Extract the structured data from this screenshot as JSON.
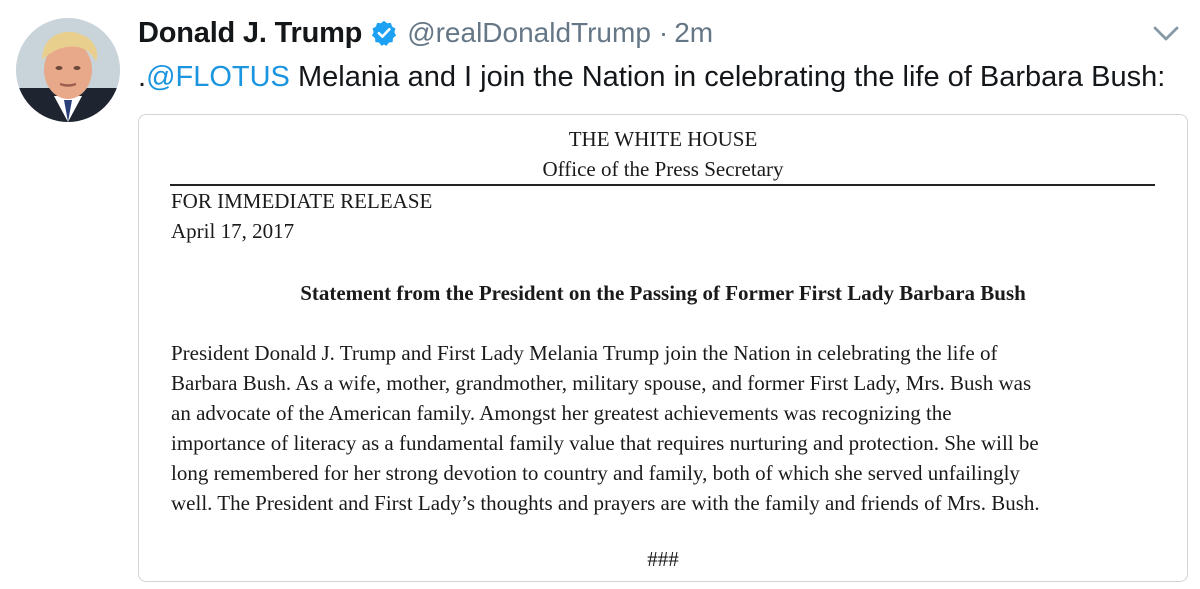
{
  "tweet": {
    "display_name": "Donald J. Trump",
    "handle": "@realDonaldTrump",
    "separator": "·",
    "time": "2m",
    "text_prefix": ".",
    "mention": "@FLOTUS",
    "text_rest": " Melania and I join the Nation in celebrating the life of Barbara Bush:",
    "icons": {
      "verified": "verified-badge-icon",
      "chevron": "chevron-down-icon",
      "avatar": "profile-avatar"
    },
    "colors": {
      "mention": "#1b95e0",
      "verified": "#1da1f2",
      "muted": "#657786"
    }
  },
  "document": {
    "org": "THE WHITE HOUSE",
    "office": "Office of the Press Secretary",
    "release": "FOR IMMEDIATE RELEASE",
    "date": "April 17, 2017",
    "title": "Statement from the President on the Passing of Former First Lady Barbara Bush",
    "body_lines": [
      "President Donald J. Trump and First Lady Melania Trump join the Nation in celebrating the life of",
      "Barbara Bush. As a wife, mother, grandmother, military spouse, and former First Lady, Mrs. Bush was",
      "an advocate of the American family. Amongst her greatest achievements was recognizing the",
      "importance of literacy as a fundamental family value that requires nurturing and protection. She will be",
      "long remembered for her strong devotion to country and family, both of which she served unfailingly",
      "well. The President and First Lady’s thoughts and prayers are with the family and friends of Mrs. Bush."
    ],
    "end_mark": "###"
  }
}
